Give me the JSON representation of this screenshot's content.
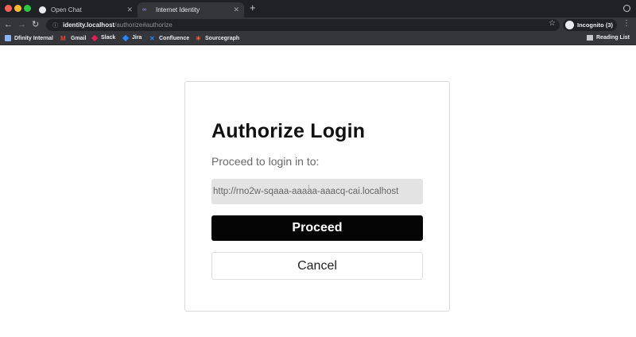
{
  "browser": {
    "tabs": [
      {
        "title": "Open Chat",
        "active": false
      },
      {
        "title": "Internet Identity",
        "active": true,
        "favicon": "∞"
      }
    ],
    "new_tab_symbol": "+",
    "url_host": "identity.localhost",
    "url_path": "/authorize#authorize",
    "profile": "Incognito (3)",
    "bookmarks": [
      {
        "label": "Dfinity Internal",
        "icon": "folder-icon"
      },
      {
        "label": "Gmail",
        "icon": "gmail-icon",
        "glyph": "M"
      },
      {
        "label": "Slack",
        "icon": "slack-icon"
      },
      {
        "label": "Jira",
        "icon": "jira-icon"
      },
      {
        "label": "Confluence",
        "icon": "confluence-icon",
        "glyph": "✕"
      },
      {
        "label": "Sourcegraph",
        "icon": "sourcegraph-icon",
        "glyph": "✳"
      }
    ],
    "reading_list": "Reading List",
    "colors": {
      "tabbar": "#202124",
      "toolbar": "#35363a"
    }
  },
  "page": {
    "title": "Authorize Login",
    "subtitle": "Proceed to login in to:",
    "app_url": "http://rno2w-sqaaa-aaaaa-aaacq-cai.localhost",
    "proceed_label": "Proceed",
    "cancel_label": "Cancel",
    "colors": {
      "proceed_bg": "#050505",
      "url_box_bg": "#e3e3e3"
    }
  }
}
